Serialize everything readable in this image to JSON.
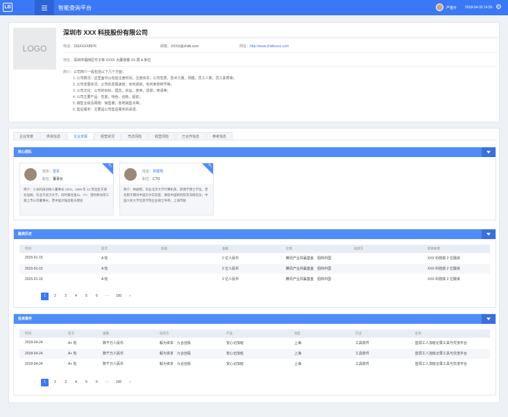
{
  "topbar": {
    "logo": "LB",
    "title": "智能查询平台",
    "user": "严晋升",
    "datetime": "2018-04-30 14:56"
  },
  "company": {
    "logo_text": "LOGO",
    "name": "深圳市 XXX 科技股份有限公司",
    "phone_label": "电话：",
    "phone": "156XXXX8976",
    "email_label": "邮箱：",
    "email": "XXXX@zhdb.com",
    "website_label": "网址：",
    "website": "http://www.zhdbxxxx.com",
    "address_label": "地址：",
    "address": "深圳市福田区竹子林 XXXX 大厦塔楼 XX 层 A 单位",
    "intro_label": "简介：",
    "intro_lead": "公司简介一般包括以下几个方面：",
    "intro_items": [
      "1. 公司概况：这里面可以包括注册时间，注册资本，公司性质，技术力量，规模，员工人数，员工素质等；",
      "2. 公司发展状况：公司的发展速度，有何成绩，有何荣誉称号等；",
      "3. 公司文化：公司的目标，理念，宗旨，使命，愿景，寄语等；",
      "4. 公司主要产品：性能，特色，创新，超前；",
      "5. 销售业绩及网络：销售量，各地销售点等；",
      "6. 售后服务：主要是公司售后服务的承诺。"
    ]
  },
  "tabs": [
    "企业背景",
    "供货信息",
    "企业发展",
    "经营状况",
    "司法风险",
    "经营风险",
    "已合作信息",
    "参考信息"
  ],
  "active_tab": "企业发展",
  "core_team": {
    "title": "核心团队",
    "badge": "核心",
    "name_label": "姓名：",
    "pos_label": "职位：",
    "people": [
      {
        "name": "雷军",
        "position": "董事长",
        "bio": "简介：小米科技创始人董事长 CEO。1969 年 12 月出生于湖北仙桃，毕业于武汉大学，同时兼任金山、YY、猎豹移动等三家上市公司董事长，曾中国大陆首批天使投"
      },
      {
        "name": "林斌明",
        "position": "CTO",
        "bio": "简介：林斌明，毕业北京大学计算机系，获博学博士学位，曾任职于朗讯中国贝尔实验室、微软中国研究院资深研究员；中国人民大学信息学院企业硕士导师，上海市般"
      }
    ]
  },
  "financing": {
    "title": "融资历史",
    "columns": [
      "时间",
      "轮次",
      "估值",
      "金额",
      "比例",
      "投资方",
      "新闻来源"
    ],
    "rows": [
      [
        "2015-01-15",
        "A 轮",
        "",
        "2 亿人民币",
        "腾讯产业共赢基金　招商中国",
        "",
        "XXX 科技获 2 亿融资"
      ],
      [
        "2015-01-15",
        "A 轮",
        "",
        "2 亿人民币",
        "腾讯产业共赢基金　招商中国",
        "",
        "XXX 科技获 2 亿融资"
      ],
      [
        "2015-01-15",
        "A 轮",
        "",
        "2 亿人民币",
        "腾讯产业共赢基金　招商中国",
        "",
        "XXX 科技获 2 亿融资"
      ]
    ],
    "pages": [
      "1",
      "2",
      "3",
      "4",
      "5",
      "6",
      "···",
      "100"
    ]
  },
  "investments": {
    "title": "投资事件",
    "columns": [
      "时间",
      "轮次",
      "金额",
      "投资方",
      "产品",
      "地区",
      "行业",
      "业务"
    ],
    "rows": [
      [
        "2018-04-24",
        "A+ 轮",
        "数千万人民币",
        "毅为资本　九合创投",
        "安心记加班",
        "上海",
        "工具软件",
        "蓝领工人加班记录工具与交流平台"
      ],
      [
        "2018-04-24",
        "A+ 轮",
        "数千万人民币",
        "毅为资本　九合创投",
        "安心记加班",
        "上海",
        "工具软件",
        "蓝领工人加班记录工具与交流平台"
      ],
      [
        "2018-04-24",
        "A+ 轮",
        "数千万人民币",
        "毅为资本　九合创投",
        "安心记加班",
        "上海",
        "工具软件",
        "蓝领工人加班记录工具与交流平台"
      ]
    ],
    "pages": [
      "1",
      "2",
      "3",
      "4",
      "5",
      "6",
      "···",
      "100"
    ]
  },
  "colors": {
    "primary": "#3a78f5",
    "section_head": "#4f8cf7",
    "background": "#eef1f6"
  }
}
